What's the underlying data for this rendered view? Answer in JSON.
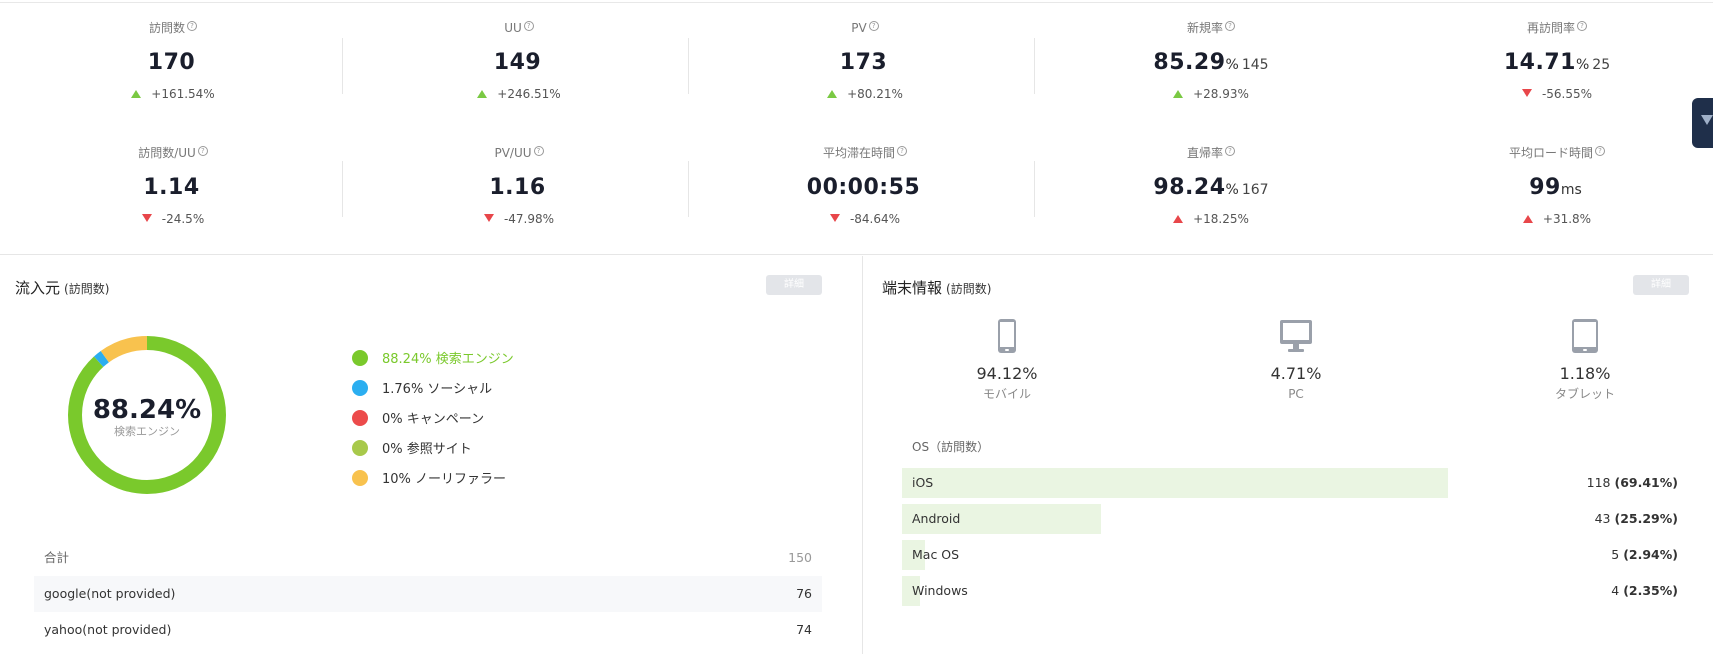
{
  "kpis_row1": [
    {
      "label": "訪問数",
      "value": "170",
      "unit": "",
      "sub": "",
      "delta": "+161.54%",
      "dir": "up-green"
    },
    {
      "label": "UU",
      "value": "149",
      "unit": "",
      "sub": "",
      "delta": "+246.51%",
      "dir": "up-green"
    },
    {
      "label": "PV",
      "value": "173",
      "unit": "",
      "sub": "",
      "delta": "+80.21%",
      "dir": "up-green"
    },
    {
      "label": "新規率",
      "value": "85.29",
      "unit": "%",
      "sub": "145",
      "delta": "+28.93%",
      "dir": "up-green"
    },
    {
      "label": "再訪問率",
      "value": "14.71",
      "unit": "%",
      "sub": "25",
      "delta": "-56.55%",
      "dir": "down-red"
    }
  ],
  "kpis_row2": [
    {
      "label": "訪問数/UU",
      "value": "1.14",
      "unit": "",
      "sub": "",
      "delta": "-24.5%",
      "dir": "down-red"
    },
    {
      "label": "PV/UU",
      "value": "1.16",
      "unit": "",
      "sub": "",
      "delta": "-47.98%",
      "dir": "down-red"
    },
    {
      "label": "平均滞在時間",
      "value": "00:00:55",
      "unit": "",
      "sub": "",
      "delta": "-84.64%",
      "dir": "down-red"
    },
    {
      "label": "直帰率",
      "value": "98.24",
      "unit": "%",
      "sub": "167",
      "delta": "+18.25%",
      "dir": "up-red"
    },
    {
      "label": "平均ロード時間",
      "value": "99",
      "unit": "ms",
      "sub": "",
      "delta": "+31.8%",
      "dir": "up-red"
    }
  ],
  "traffic": {
    "title": "流入元",
    "title_sub": "(訪問数)",
    "detail_label": "詳細",
    "center_pct": "88.24%",
    "center_label": "検索エンジン",
    "legend": [
      {
        "text": "88.24% 検索エンジン",
        "color": "#7ac92c",
        "text_color": "#7ac92c",
        "share": 88.24
      },
      {
        "text": "1.76% ソーシャル",
        "color": "#2baef0",
        "text_color": "#333333",
        "share": 1.76
      },
      {
        "text": "0% キャンペーン",
        "color": "#ec4b4b",
        "text_color": "#333333",
        "share": 0
      },
      {
        "text": "0% 参照サイト",
        "color": "#a8c94b",
        "text_color": "#333333",
        "share": 0
      },
      {
        "text": "10% ノーリファラー",
        "color": "#f8c24e",
        "text_color": "#333333",
        "share": 10
      }
    ],
    "table": [
      {
        "name": "合計",
        "value": "150"
      },
      {
        "name": "google(not provided)",
        "value": "76"
      },
      {
        "name": "yahoo(not provided)",
        "value": "74"
      }
    ]
  },
  "device": {
    "title": "端末情報",
    "title_sub": "(訪問数)",
    "detail_label": "詳細",
    "items": [
      {
        "pct": "94.12%",
        "name": "モバイル",
        "icon": "mobile-icon"
      },
      {
        "pct": "4.71%",
        "name": "PC",
        "icon": "desktop-icon"
      },
      {
        "pct": "1.18%",
        "name": "タブレット",
        "icon": "tablet-icon"
      }
    ],
    "os_title": "OS（訪問数）",
    "os": [
      {
        "name": "iOS",
        "count": "118",
        "pct": "(69.41%)",
        "share": 69.41
      },
      {
        "name": "Android",
        "count": "43",
        "pct": "(25.29%)",
        "share": 25.29
      },
      {
        "name": "Mac OS",
        "count": "5",
        "pct": "(2.94%)",
        "share": 2.94
      },
      {
        "name": "Windows",
        "count": "4",
        "pct": "(2.35%)",
        "share": 2.35
      }
    ]
  },
  "colors": {
    "accent_green": "#7ac943",
    "accent_red": "#e8464a",
    "bar_fill": "#eaf5e2"
  }
}
